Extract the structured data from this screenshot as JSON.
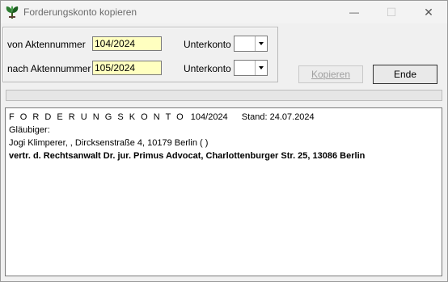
{
  "window": {
    "title": "Forderungskonto kopieren",
    "minimize_glyph": "—",
    "maximize_glyph": "☐",
    "close_glyph": "✕"
  },
  "form": {
    "from_label": "von Aktennummer",
    "from_value": "104/2024",
    "to_label": "nach Aktennummer",
    "to_value": "105/2024",
    "subaccount_label_1": "Unterkonto",
    "subaccount_label_2": "Unterkonto",
    "subaccount_value_1": "",
    "subaccount_value_2": ""
  },
  "buttons": {
    "copy": "Kopieren",
    "end": "Ende"
  },
  "progress": {
    "value": 0
  },
  "content": {
    "heading": "F O R D E R U N G S K O N T O",
    "heading_ref": "104/2024",
    "stand": "Stand: 24.07.2024",
    "glaeubiger_label": "Gläubiger:",
    "glaeubiger": "Jogi Klimperer, , Dircksenstraße 4, 10179 Berlin ( )",
    "vertreter": "vertr. d. Rechtsanwalt Dr. jur. Primus Advocat, Charlottenburger Str. 25, 13086 Berlin"
  },
  "colors": {
    "input_bg": "#ffffc0",
    "window_bg": "#f0f0f0",
    "icon_green": "#2e7d32"
  }
}
